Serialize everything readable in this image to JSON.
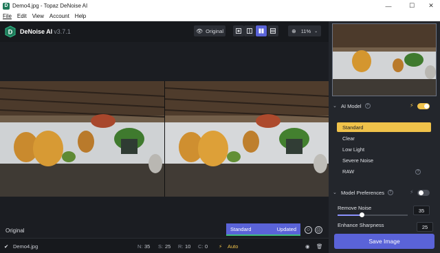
{
  "window": {
    "title": "Demo4.jpg - Topaz DeNoise AI"
  },
  "menu": [
    "File",
    "Edit",
    "View",
    "Account",
    "Help"
  ],
  "app": {
    "name": "DeNoise AI",
    "version": "v3.7.1"
  },
  "toolbar": {
    "original_label": "Original",
    "zoom_value": "11%"
  },
  "compare": {
    "original_label": "Original",
    "model_label": "Standard",
    "model_status": "Updated"
  },
  "status": {
    "filename": "Demo4.jpg",
    "n_label": "N:",
    "n_value": "35",
    "s_label": "S:",
    "s_value": "25",
    "r_label": "R:",
    "r_value": "10",
    "c_label": "C:",
    "c_value": "0",
    "mode": "Auto"
  },
  "sidebar": {
    "ai_model": {
      "title": "AI Model",
      "auto_on": true,
      "models": [
        "Standard",
        "Clear",
        "Low Light",
        "Severe Noise",
        "RAW"
      ],
      "selected": "Standard"
    },
    "preferences": {
      "title": "Model Preferences",
      "auto_on": false,
      "remove_noise": {
        "label": "Remove Noise",
        "value": "35",
        "fraction": 0.35
      },
      "enhance_sharpness": {
        "label": "Enhance Sharpness",
        "value": "25",
        "fraction": 0.25
      }
    },
    "save_label": "Save Image"
  },
  "colors": {
    "accent": "#5a63d8",
    "selected_model": "#f0c24a",
    "toggle_on": "#f0c24a"
  }
}
